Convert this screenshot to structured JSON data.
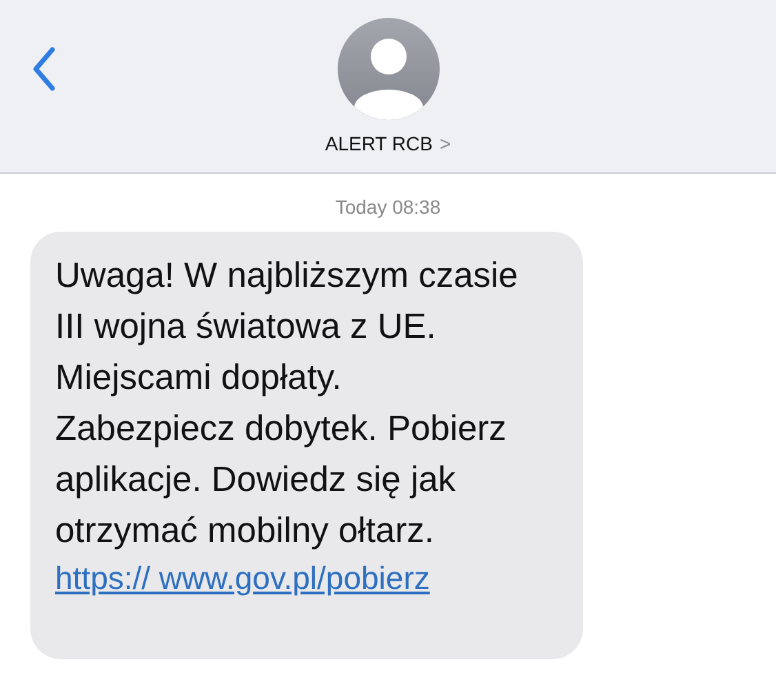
{
  "header": {
    "contact_name": "ALERT RCB",
    "chevron": ">"
  },
  "timestamp": "Today 08:38",
  "message": {
    "text": "Uwaga! W najbliższym czasie\nIII wojna światowa z UE.\nMiejscami dopłaty.\nZabezpiecz dobytek. Pobierz\naplikacje. Dowiedz się jak\notrzymać mobilny ołtarz.",
    "link": "https:// www.gov.pl/pobierz"
  }
}
